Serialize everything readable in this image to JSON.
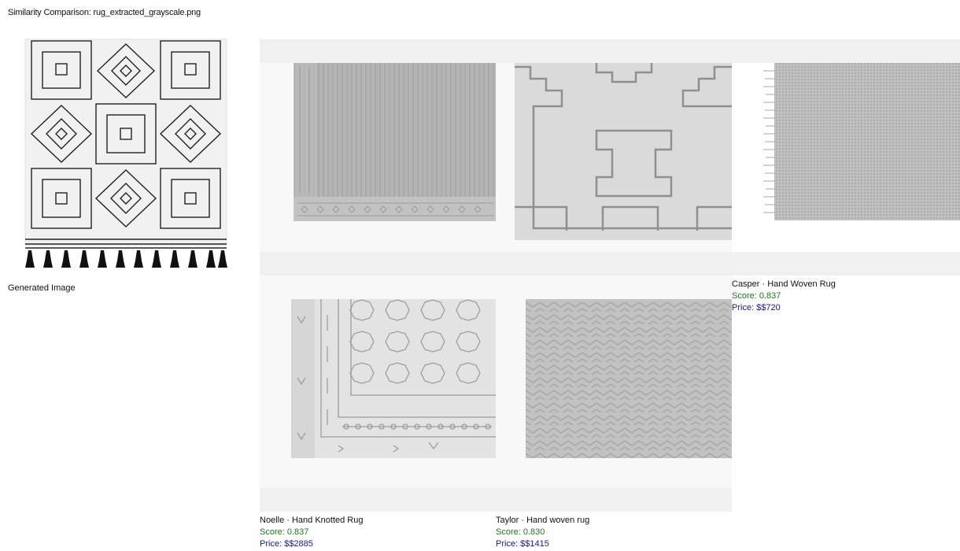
{
  "header": {
    "title": "Similarity Comparison: rug_extracted_grayscale.png"
  },
  "generated": {
    "caption": "Generated Image",
    "icon": "rug-generated-image"
  },
  "results": [
    {
      "name": "Casper · Hand Woven Rug",
      "score": "Score: 0.837",
      "price": "Price: $$720"
    },
    {
      "name": "Noelle · Hand Knotted Rug",
      "score": "Score: 0.837",
      "price": "Price: $$2885"
    },
    {
      "name": "Taylor · Hand woven rug",
      "score": "Score: 0.830",
      "price": "Price: $$1415"
    }
  ],
  "colors": {
    "score": "#1a7a1a",
    "price": "#1a1a8a",
    "band": "#f0f0f0",
    "panel": "#f8f8f8"
  }
}
